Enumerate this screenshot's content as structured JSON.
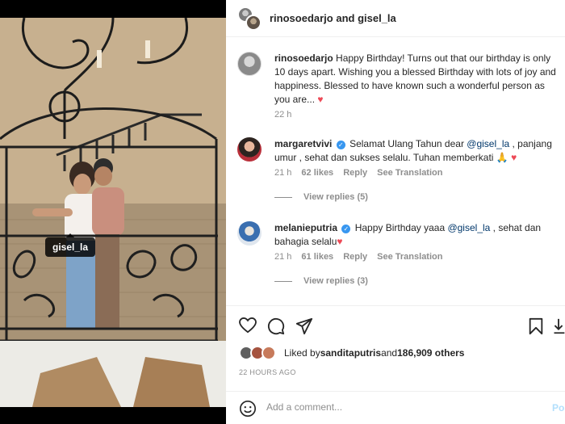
{
  "photo": {
    "tag": "gisel_la"
  },
  "header": {
    "usernames": "rinosoedarjo and gisel_la"
  },
  "caption": {
    "username": "rinosoedarjo",
    "text": "Happy Birthday! Turns out that our birthday is only 10 days apart. Wishing you a blessed Birthday with lots of joy and happiness. Blessed to have known such a wonderful person as you are...",
    "emoji": "♥",
    "time": "22 h"
  },
  "comments": [
    {
      "username": "margaretvivi",
      "text_pre": "Selamat Ulang Tahun dear ",
      "mention": "@gisel_la",
      "text_post": " , panjang umur , sehat dan sukses selalu. Tuhan memberkati 🙏",
      "emoji": "♥",
      "time": "21 h",
      "likes": "62 likes",
      "reply": "Reply",
      "translation": "See Translation",
      "view_replies": "View replies (5)"
    },
    {
      "username": "melanieputria",
      "text_pre": "Happy Birthday yaaa ",
      "mention": "@gisel_la",
      "text_post": " , sehat dan bahagia selalu",
      "emoji": "♥",
      "time": "21 h",
      "likes": "61 likes",
      "reply": "Reply",
      "translation": "See Translation",
      "view_replies": "View replies (3)"
    }
  ],
  "likes": {
    "prefix": "Liked by ",
    "user": "sanditaputris",
    "and": " and ",
    "count": "186,909 others"
  },
  "timestamp": "22 HOURS AGO",
  "add_comment": {
    "placeholder": "Add a comment...",
    "post_label": "Post"
  },
  "icons": [
    "heart-icon",
    "comment-icon",
    "share-icon",
    "bookmark-icon",
    "emoji-icon",
    "verified-badge-icon"
  ],
  "colors": {
    "link": "#00376b",
    "verified": "#3897f0",
    "heart": "#ed4956",
    "muted": "#8e8e8e",
    "post": "#b2dffc"
  }
}
